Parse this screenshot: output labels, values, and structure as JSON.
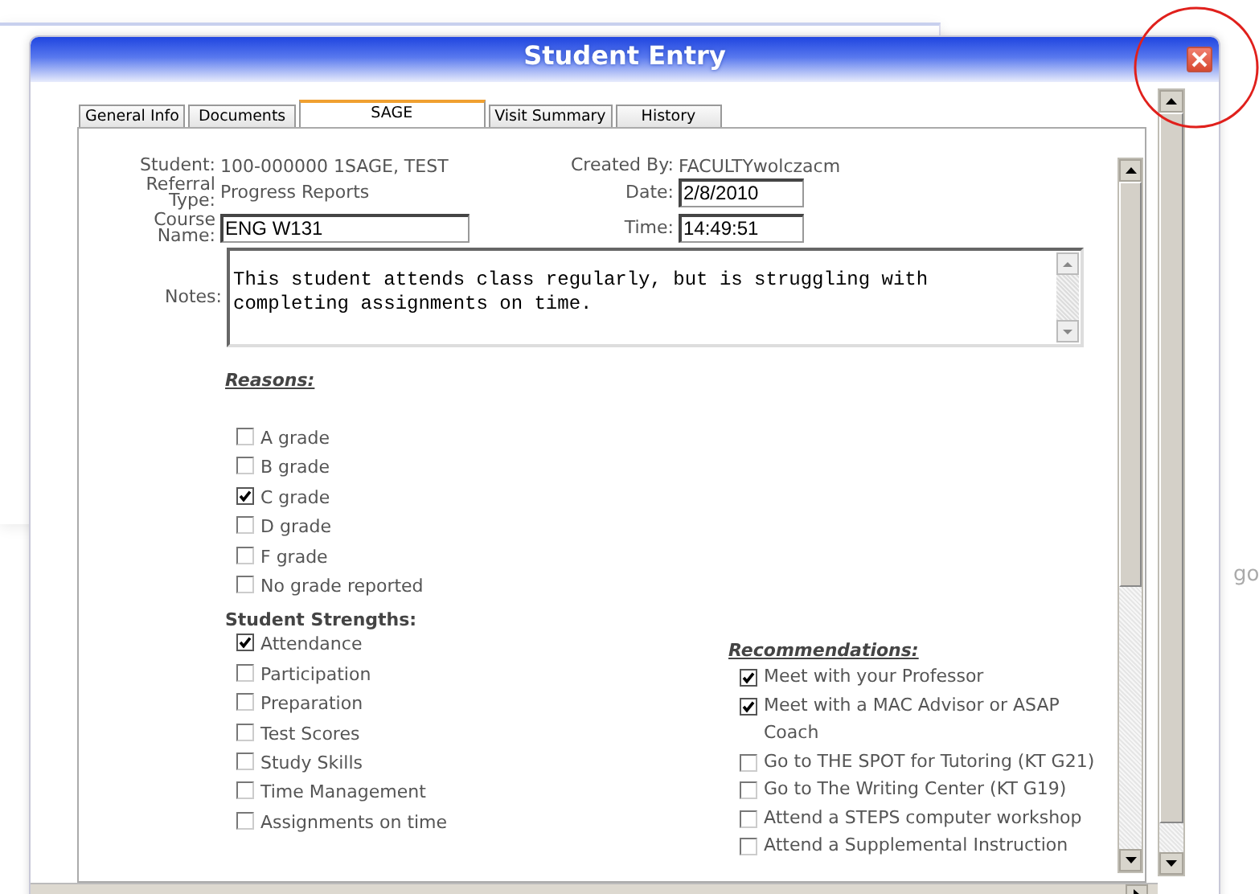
{
  "window": {
    "title": "Student Entry"
  },
  "background_text": "go",
  "tabs": [
    {
      "label": "General Info",
      "selected": false
    },
    {
      "label": "Documents",
      "selected": false
    },
    {
      "label": "SAGE",
      "selected": true
    },
    {
      "label": "Visit Summary",
      "selected": false
    },
    {
      "label": "History",
      "selected": false
    }
  ],
  "header_left": [
    {
      "kind": "text",
      "label": "Student:",
      "value": "100-000000 1SAGE, TEST"
    },
    {
      "kind": "text",
      "label": "Referral Type:",
      "value": "Progress Reports"
    },
    {
      "kind": "input",
      "label": "Course Name:",
      "value": "ENG W131"
    }
  ],
  "header_right": [
    {
      "kind": "text",
      "label": "Created By:",
      "value": "FACULTYwolczacm"
    },
    {
      "kind": "input",
      "label": "Date:",
      "value": "2/8/2010"
    },
    {
      "kind": "input",
      "label": "Time:",
      "value": "14:49:51"
    }
  ],
  "notes": {
    "label": "Notes:",
    "value": "This student attends class regularly, but is struggling with completing assignments on time."
  },
  "reasons": {
    "title": "Reasons:",
    "items": [
      {
        "label": "A grade",
        "checked": false
      },
      {
        "label": "B grade",
        "checked": false
      },
      {
        "label": "C grade",
        "checked": true
      },
      {
        "label": "D grade",
        "checked": false
      },
      {
        "label": "F grade",
        "checked": false
      },
      {
        "label": "No grade reported",
        "checked": false
      }
    ]
  },
  "strengths": {
    "title": "Student Strengths:",
    "items": [
      {
        "label": "Attendance",
        "checked": true
      },
      {
        "label": "Participation",
        "checked": false
      },
      {
        "label": "Preparation",
        "checked": false
      },
      {
        "label": "Test Scores",
        "checked": false
      },
      {
        "label": "Study Skills",
        "checked": false
      },
      {
        "label": "Time Management",
        "checked": false
      },
      {
        "label": "Assignments on time",
        "checked": false
      }
    ]
  },
  "recommendations": {
    "title": "Recommendations:",
    "items": [
      {
        "label": "Meet with your Professor",
        "checked": true
      },
      {
        "label": "Meet with a MAC Advisor or ASAP Coach",
        "checked": true
      },
      {
        "label": "Go to THE SPOT for Tutoring (KT G21)",
        "checked": false
      },
      {
        "label": "Go to The Writing Center (KT G19)",
        "checked": false
      },
      {
        "label": "Attend a STEPS computer workshop",
        "checked": false
      },
      {
        "label": "Attend a Supplemental Instruction",
        "checked": false
      }
    ]
  }
}
